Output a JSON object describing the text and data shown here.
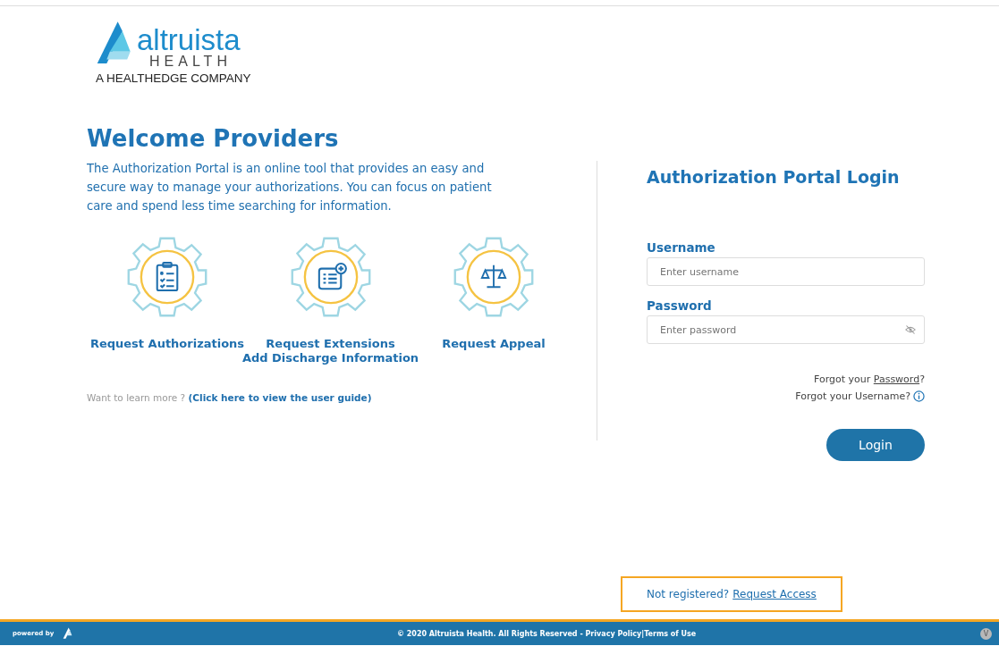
{
  "logo": {
    "name": "altruista",
    "subtitle": "HEALTH",
    "tagline": "A HEALTHEDGE COMPANY"
  },
  "intro": {
    "title": "Welcome Providers",
    "text": "The Authorization Portal is an online tool that provides an easy and secure way to manage your authorizations. You can focus on patient care and spend less time searching for information."
  },
  "features": [
    {
      "kind": "clipboard",
      "lines": [
        "Request Authorizations"
      ]
    },
    {
      "kind": "document",
      "lines": [
        "Request Extensions",
        "Add Discharge Information"
      ]
    },
    {
      "kind": "scales",
      "lines": [
        "Request Appeal"
      ]
    }
  ],
  "learn_more": {
    "text": "Want to learn more ?",
    "link": "(Click here to view the user guide)"
  },
  "login": {
    "title": "Authorization Portal Login",
    "username_label": "Username",
    "username_placeholder": "Enter username",
    "password_label": "Password",
    "password_placeholder": "Enter password",
    "forgot_password_prefix": "Forgot your",
    "forgot_password_link": "Password",
    "forgot_password_suffix": "?",
    "forgot_username": "Forgot your Username?",
    "button": "Login"
  },
  "register": {
    "text": "Not registered?",
    "link": "Request Access"
  },
  "footer": {
    "powered_by": "powered by",
    "copyright": "© 2020 Altruista Health. All Rights Reserved -",
    "privacy": "Privacy Policy",
    "separator": "|",
    "terms": "Terms of Use",
    "version_badge": "V"
  }
}
